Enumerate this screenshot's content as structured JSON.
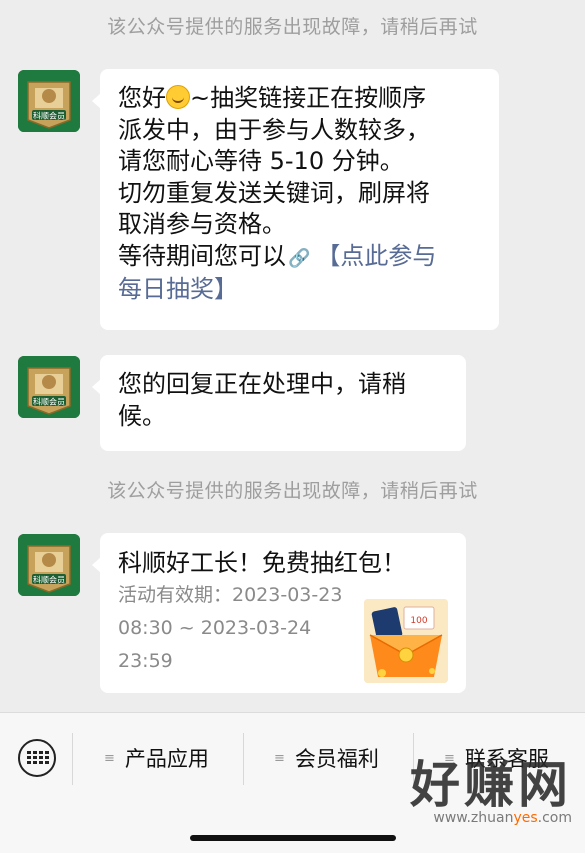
{
  "system_notice": "该公众号提供的服务出现故障，请稍后再试",
  "avatar_label": "科顺会员",
  "message1": {
    "lines": [
      "~抽奖链接正在按顺序",
      "派发中，由于参与人数较多，",
      "请您耐心等待 5-10 分钟。",
      "切勿重复发送关键词，刷屏将",
      "取消参与资格。",
      "等待期间您可以"
    ],
    "greeting": "您好",
    "link_text_1": "【点此参与",
    "link_text_2": "每日抽奖】"
  },
  "message2": {
    "lines": [
      "您的回复正在处理中，请稍",
      "候。"
    ]
  },
  "message3": {
    "title": "科顺好工长！免费抽红包！",
    "sub": "活动有效期：2023-03-23 08:30 ~ 2023-03-24 23:59",
    "image_badge": "100"
  },
  "bottom_menu": {
    "items": [
      {
        "label": "产品应用"
      },
      {
        "label": "会员福利"
      },
      {
        "label": "联系客服"
      }
    ]
  },
  "watermark": {
    "brand": "好赚网",
    "url_a": "www.zhuan",
    "url_b": "yes",
    "url_c": ".com"
  }
}
